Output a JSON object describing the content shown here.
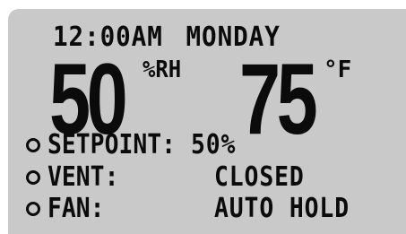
{
  "status_bar": {
    "time": "12:00AM",
    "day": "MONDAY"
  },
  "readings": {
    "humidity": {
      "value": "50",
      "unit": "%RH"
    },
    "temperature": {
      "value": "75",
      "unit": "°F"
    }
  },
  "menu": {
    "items": [
      {
        "label": "SETPOINT:",
        "value": "50%"
      },
      {
        "label": "VENT:",
        "value": "CLOSED"
      },
      {
        "label": "FAN:",
        "value": "AUTO HOLD"
      }
    ]
  }
}
